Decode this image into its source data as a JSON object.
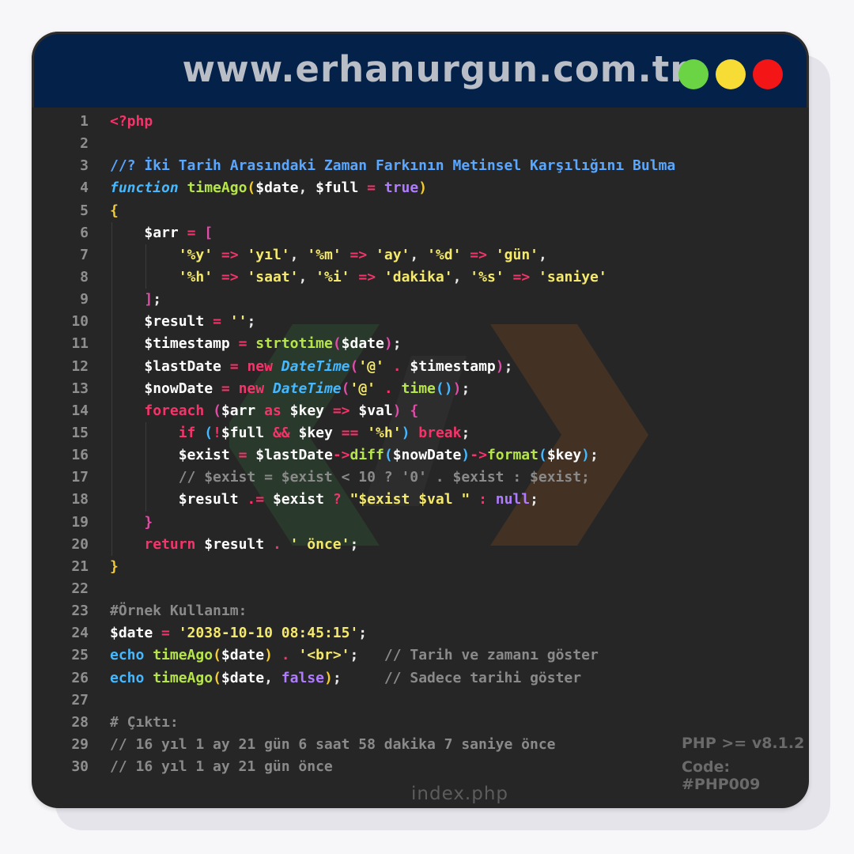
{
  "header": {
    "site": "www.erhanurgun.com.tr",
    "window_controls": [
      "green",
      "yellow",
      "red"
    ],
    "colors": {
      "bg": "#04214a",
      "green": "#6bd445",
      "yellow": "#f7dc35",
      "red": "#f41616"
    }
  },
  "editor": {
    "line_numbers": [
      "1",
      "2",
      "3",
      "4",
      "5",
      "6",
      "7",
      "8",
      "9",
      "10",
      "11",
      "12",
      "13",
      "14",
      "15",
      "16",
      "17",
      "18",
      "19",
      "20",
      "21",
      "22",
      "23",
      "24",
      "25",
      "26",
      "27",
      "28",
      "29",
      "30"
    ],
    "lines": [
      [
        [
          "tag",
          "<?php"
        ]
      ],
      [],
      [
        [
          "cmt",
          "//? İki Tarih Arasındaki Zaman Farkının Metinsel Karşılığını Bulma"
        ]
      ],
      [
        [
          "kw",
          "function"
        ],
        [
          "pl",
          " "
        ],
        [
          "fn",
          "timeAgo"
        ],
        [
          "b1",
          "("
        ],
        [
          "var",
          "$date"
        ],
        [
          "pl",
          ", "
        ],
        [
          "var",
          "$full"
        ],
        [
          "pl",
          " "
        ],
        [
          "op",
          "="
        ],
        [
          "pl",
          " "
        ],
        [
          "bool",
          "true"
        ],
        [
          "b1",
          ")"
        ]
      ],
      [
        [
          "b1",
          "{"
        ]
      ],
      [
        [
          "pl",
          "    "
        ],
        [
          "var",
          "$arr"
        ],
        [
          "pl",
          " "
        ],
        [
          "op",
          "="
        ],
        [
          "pl",
          " "
        ],
        [
          "b2",
          "["
        ]
      ],
      [
        [
          "pl",
          "        "
        ],
        [
          "str",
          "'%y'"
        ],
        [
          "pl",
          " "
        ],
        [
          "op",
          "=>"
        ],
        [
          "pl",
          " "
        ],
        [
          "str",
          "'yıl'"
        ],
        [
          "pl",
          ", "
        ],
        [
          "str",
          "'%m'"
        ],
        [
          "pl",
          " "
        ],
        [
          "op",
          "=>"
        ],
        [
          "pl",
          " "
        ],
        [
          "str",
          "'ay'"
        ],
        [
          "pl",
          ", "
        ],
        [
          "str",
          "'%d'"
        ],
        [
          "pl",
          " "
        ],
        [
          "op",
          "=>"
        ],
        [
          "pl",
          " "
        ],
        [
          "str",
          "'gün'"
        ],
        [
          "pl",
          ","
        ]
      ],
      [
        [
          "pl",
          "        "
        ],
        [
          "str",
          "'%h'"
        ],
        [
          "pl",
          " "
        ],
        [
          "op",
          "=>"
        ],
        [
          "pl",
          " "
        ],
        [
          "str",
          "'saat'"
        ],
        [
          "pl",
          ", "
        ],
        [
          "str",
          "'%i'"
        ],
        [
          "pl",
          " "
        ],
        [
          "op",
          "=>"
        ],
        [
          "pl",
          " "
        ],
        [
          "str",
          "'dakika'"
        ],
        [
          "pl",
          ", "
        ],
        [
          "str",
          "'%s'"
        ],
        [
          "pl",
          " "
        ],
        [
          "op",
          "=>"
        ],
        [
          "pl",
          " "
        ],
        [
          "str",
          "'saniye'"
        ]
      ],
      [
        [
          "pl",
          "    "
        ],
        [
          "b2",
          "]"
        ],
        [
          "pl",
          ";"
        ]
      ],
      [
        [
          "pl",
          "    "
        ],
        [
          "var",
          "$result"
        ],
        [
          "pl",
          " "
        ],
        [
          "op",
          "="
        ],
        [
          "pl",
          " "
        ],
        [
          "str",
          "''"
        ],
        [
          "pl",
          ";"
        ]
      ],
      [
        [
          "pl",
          "    "
        ],
        [
          "var",
          "$timestamp"
        ],
        [
          "pl",
          " "
        ],
        [
          "op",
          "="
        ],
        [
          "pl",
          " "
        ],
        [
          "fn",
          "strtotime"
        ],
        [
          "b2",
          "("
        ],
        [
          "var",
          "$date"
        ],
        [
          "b2",
          ")"
        ],
        [
          "pl",
          ";"
        ]
      ],
      [
        [
          "pl",
          "    "
        ],
        [
          "var",
          "$lastDate"
        ],
        [
          "pl",
          " "
        ],
        [
          "op",
          "="
        ],
        [
          "pl",
          " "
        ],
        [
          "op",
          "new"
        ],
        [
          "pl",
          " "
        ],
        [
          "cls",
          "DateTime"
        ],
        [
          "b2",
          "("
        ],
        [
          "str",
          "'@'"
        ],
        [
          "pl",
          " "
        ],
        [
          "op",
          "."
        ],
        [
          "pl",
          " "
        ],
        [
          "var",
          "$timestamp"
        ],
        [
          "b2",
          ")"
        ],
        [
          "pl",
          ";"
        ]
      ],
      [
        [
          "pl",
          "    "
        ],
        [
          "var",
          "$nowDate"
        ],
        [
          "pl",
          " "
        ],
        [
          "op",
          "="
        ],
        [
          "pl",
          " "
        ],
        [
          "op",
          "new"
        ],
        [
          "pl",
          " "
        ],
        [
          "cls",
          "DateTime"
        ],
        [
          "b2",
          "("
        ],
        [
          "str",
          "'@'"
        ],
        [
          "pl",
          " "
        ],
        [
          "op",
          "."
        ],
        [
          "pl",
          " "
        ],
        [
          "fn",
          "time"
        ],
        [
          "b3",
          "()"
        ],
        [
          "b2",
          ")"
        ],
        [
          "pl",
          ";"
        ]
      ],
      [
        [
          "pl",
          "    "
        ],
        [
          "op",
          "foreach"
        ],
        [
          "pl",
          " "
        ],
        [
          "b2",
          "("
        ],
        [
          "var",
          "$arr"
        ],
        [
          "pl",
          " "
        ],
        [
          "op",
          "as"
        ],
        [
          "pl",
          " "
        ],
        [
          "var",
          "$key"
        ],
        [
          "pl",
          " "
        ],
        [
          "op",
          "=>"
        ],
        [
          "pl",
          " "
        ],
        [
          "var",
          "$val"
        ],
        [
          "b2",
          ")"
        ],
        [
          "pl",
          " "
        ],
        [
          "b2",
          "{"
        ]
      ],
      [
        [
          "pl",
          "        "
        ],
        [
          "op",
          "if"
        ],
        [
          "pl",
          " "
        ],
        [
          "b3",
          "("
        ],
        [
          "op",
          "!"
        ],
        [
          "var",
          "$full"
        ],
        [
          "pl",
          " "
        ],
        [
          "op",
          "&&"
        ],
        [
          "pl",
          " "
        ],
        [
          "var",
          "$key"
        ],
        [
          "pl",
          " "
        ],
        [
          "op",
          "=="
        ],
        [
          "pl",
          " "
        ],
        [
          "str",
          "'%h'"
        ],
        [
          "b3",
          ")"
        ],
        [
          "pl",
          " "
        ],
        [
          "op",
          "break"
        ],
        [
          "pl",
          ";"
        ]
      ],
      [
        [
          "pl",
          "        "
        ],
        [
          "var",
          "$exist"
        ],
        [
          "pl",
          " "
        ],
        [
          "op",
          "="
        ],
        [
          "pl",
          " "
        ],
        [
          "var",
          "$lastDate"
        ],
        [
          "op",
          "->"
        ],
        [
          "fn",
          "diff"
        ],
        [
          "b3",
          "("
        ],
        [
          "var",
          "$nowDate"
        ],
        [
          "b3",
          ")"
        ],
        [
          "op",
          "->"
        ],
        [
          "fn",
          "format"
        ],
        [
          "b3",
          "("
        ],
        [
          "var",
          "$key"
        ],
        [
          "b3",
          ")"
        ],
        [
          "pl",
          ";"
        ]
      ],
      [
        [
          "pl",
          "        "
        ],
        [
          "gray",
          "// $exist = $exist < 10 ? '0' . $exist : $exist;"
        ]
      ],
      [
        [
          "pl",
          "        "
        ],
        [
          "var",
          "$result"
        ],
        [
          "pl",
          " "
        ],
        [
          "op",
          ".="
        ],
        [
          "pl",
          " "
        ],
        [
          "var",
          "$exist"
        ],
        [
          "pl",
          " "
        ],
        [
          "op",
          "?"
        ],
        [
          "pl",
          " "
        ],
        [
          "str",
          "\"$exist $val \""
        ],
        [
          "pl",
          " "
        ],
        [
          "op",
          ":"
        ],
        [
          "pl",
          " "
        ],
        [
          "bool",
          "null"
        ],
        [
          "pl",
          ";"
        ]
      ],
      [
        [
          "pl",
          "    "
        ],
        [
          "b2",
          "}"
        ]
      ],
      [
        [
          "pl",
          "    "
        ],
        [
          "op",
          "return"
        ],
        [
          "pl",
          " "
        ],
        [
          "var",
          "$result"
        ],
        [
          "pl",
          " "
        ],
        [
          "op",
          "."
        ],
        [
          "pl",
          " "
        ],
        [
          "str",
          "' önce'"
        ],
        [
          "pl",
          ";"
        ]
      ],
      [
        [
          "b1",
          "}"
        ]
      ],
      [],
      [
        [
          "gray",
          "#Örnek Kullanım:"
        ]
      ],
      [
        [
          "var",
          "$date"
        ],
        [
          "pl",
          " "
        ],
        [
          "op",
          "="
        ],
        [
          "pl",
          " "
        ],
        [
          "str",
          "'2038-10-10 08:45:15'"
        ],
        [
          "pl",
          ";"
        ]
      ],
      [
        [
          "kw2",
          "echo"
        ],
        [
          "pl",
          " "
        ],
        [
          "fn",
          "timeAgo"
        ],
        [
          "b1",
          "("
        ],
        [
          "var",
          "$date"
        ],
        [
          "b1",
          ")"
        ],
        [
          "pl",
          " "
        ],
        [
          "op",
          "."
        ],
        [
          "pl",
          " "
        ],
        [
          "str",
          "'<br>'"
        ],
        [
          "pl",
          ";   "
        ],
        [
          "gray",
          "// Tarih ve zamanı göster"
        ]
      ],
      [
        [
          "kw2",
          "echo"
        ],
        [
          "pl",
          " "
        ],
        [
          "fn",
          "timeAgo"
        ],
        [
          "b1",
          "("
        ],
        [
          "var",
          "$date"
        ],
        [
          "pl",
          ", "
        ],
        [
          "bool",
          "false"
        ],
        [
          "b1",
          ")"
        ],
        [
          "pl",
          ";     "
        ],
        [
          "gray",
          "// Sadece tarihi göster"
        ]
      ],
      [],
      [
        [
          "gray",
          "# Çıktı:"
        ]
      ],
      [
        [
          "gray",
          "// 16 yıl 1 ay 21 gün 6 saat 58 dakika 7 saniye önce"
        ]
      ],
      [
        [
          "gray",
          "// 16 yıl 1 ay 21 gün önce"
        ]
      ]
    ]
  },
  "footer": {
    "file_name": "index.php",
    "php_version": "PHP >= v8.1.2",
    "code_id": "Code: #PHP009"
  }
}
